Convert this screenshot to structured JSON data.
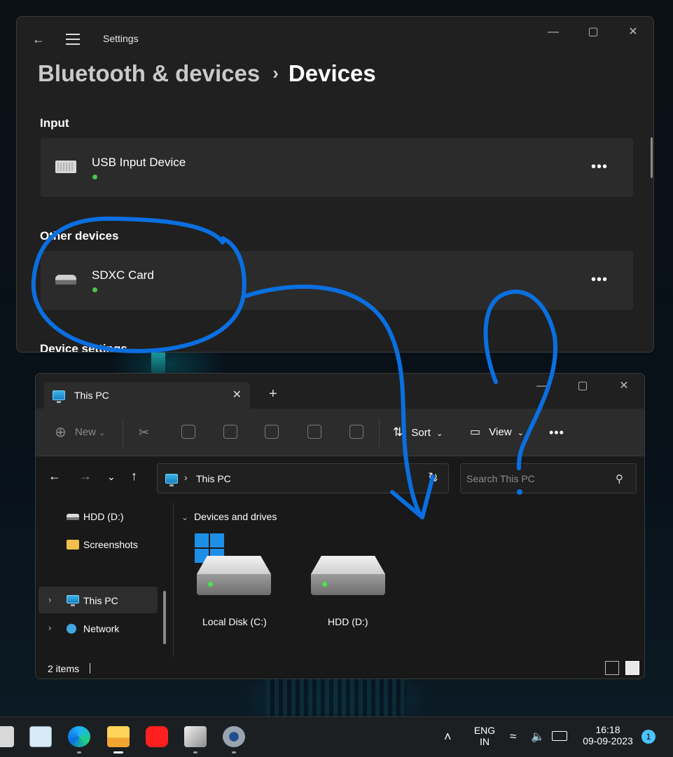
{
  "settings": {
    "app_title": "Settings",
    "breadcrumb": {
      "parent": "Bluetooth & devices",
      "separator": "›",
      "current": "Devices"
    },
    "sections": {
      "input": {
        "title": "Input",
        "device": {
          "name": "USB Input Device",
          "icon": "keyboard-icon",
          "status_color": "#4ec44e"
        }
      },
      "other": {
        "title": "Other devices",
        "device": {
          "name": "SDXC Card",
          "icon": "drive-icon",
          "status_color": "#4ec44e"
        }
      },
      "device_settings": {
        "title": "Device settings"
      }
    },
    "more_label": "•••",
    "window_controls": {
      "minimize": "—",
      "maximize": "▢",
      "close": "✕"
    }
  },
  "explorer": {
    "tab": {
      "label": "This PC",
      "close": "✕"
    },
    "new_tab": "+",
    "toolbar": {
      "new_label": "New",
      "sort_label": "Sort",
      "view_label": "View",
      "more": "•••"
    },
    "window_controls": {
      "minimize": "—",
      "maximize": "▢",
      "close": "✕"
    },
    "address": {
      "chevron": "›",
      "path": "This PC"
    },
    "search": {
      "placeholder": "Search This PC"
    },
    "nav_pane": [
      {
        "label": "HDD (D:)",
        "icon": "hdd-icon"
      },
      {
        "label": "Screenshots",
        "icon": "folder-icon"
      },
      {
        "label": "This PC",
        "icon": "pc-icon",
        "selected": true
      },
      {
        "label": "Network",
        "icon": "network-icon"
      }
    ],
    "group": {
      "label": "Devices and drives"
    },
    "drives": [
      {
        "label": "Local Disk (C:)",
        "system": true
      },
      {
        "label": "HDD (D:)",
        "system": false
      }
    ],
    "status": {
      "item_count": "2 items"
    }
  },
  "taskbar": {
    "apps": [
      "performance-monitor-icon",
      "edge-icon",
      "file-explorer-icon",
      "youtube-icon",
      "package-icon",
      "settings-icon"
    ],
    "language": {
      "line1": "ENG",
      "line2": "IN"
    },
    "clock": {
      "time": "16:18",
      "date": "09-09-2023"
    },
    "notification_count": "1"
  },
  "colors": {
    "accent": "#4cc2ff",
    "status_green": "#4ec44e",
    "annotation_blue": "#0a6fe0"
  }
}
